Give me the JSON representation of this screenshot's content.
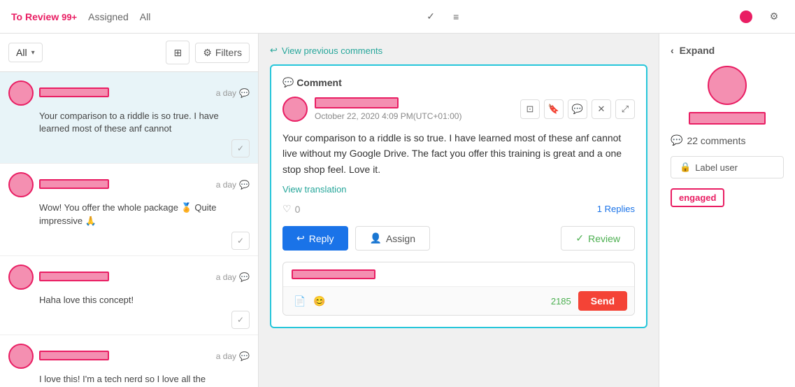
{
  "topnav": {
    "tabs": [
      {
        "label": "To Review",
        "badge": "99+",
        "active": true
      },
      {
        "label": "Assigned",
        "active": false
      },
      {
        "label": "All",
        "active": false
      }
    ],
    "expand_label": "Expand"
  },
  "sidebar": {
    "filter": {
      "value": "All",
      "placeholder": "All"
    },
    "filters_btn": "Filters",
    "comments": [
      {
        "time": "a day",
        "text": "Your comparison to a riddle is so true. I have learned most of these anf cannot",
        "active": true
      },
      {
        "time": "a day",
        "text": "Wow! You offer the whole package 🏅 Quite impressive 🙏",
        "active": false
      },
      {
        "time": "a day",
        "text": "Haha love this concept!",
        "active": false
      },
      {
        "time": "a day",
        "text": "I love this! I'm a tech nerd so I love all the",
        "active": false
      }
    ]
  },
  "center": {
    "view_prev_label": "View previous comments",
    "section_title": "Comment",
    "author_time": "October 22, 2020 4:09 PM(UTC+01:00)",
    "comment_body": "Your comparison to a riddle is so true.  I have learned most of these anf cannot live without my Google Drive. The fact you offer this training is great and a one stop shop feel. Love it.",
    "view_translation": "View translation",
    "like_count": "0",
    "replies_link": "1 Replies",
    "btn_reply": "Reply",
    "btn_assign": "Assign",
    "btn_review": "Review",
    "char_count": "2185",
    "btn_send": "Send"
  },
  "right": {
    "expand_label": "Expand",
    "comments_count": "22 comments",
    "btn_label": "Label user",
    "tag_engaged": "engaged"
  },
  "icons": {
    "check": "✓",
    "chat": "💬",
    "chevron_left": "‹",
    "chevron_down": "▾",
    "grid": "⊞",
    "sliders": "⚙",
    "arrow_left": "←",
    "reply_arrow": "↩",
    "person": "👤",
    "check_green": "✓",
    "copy": "⊡",
    "bookmark": "🔖",
    "chat2": "💬",
    "x": "✕",
    "expand2": "⤢",
    "heart": "♡",
    "doc": "📄",
    "emoji": "😊",
    "lock": "🔒",
    "tag": "🏷"
  }
}
